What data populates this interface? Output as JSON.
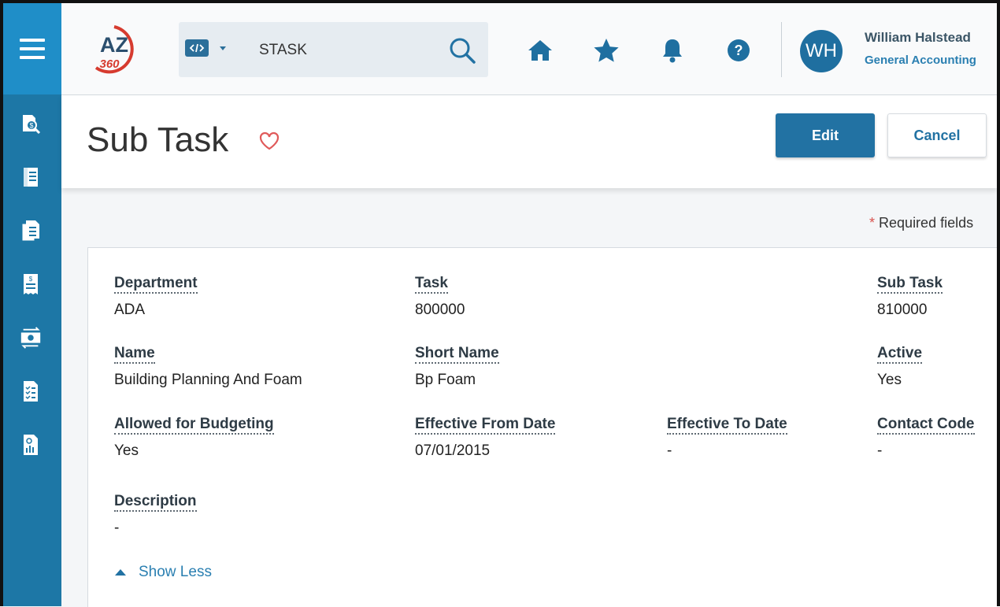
{
  "header": {
    "logo_text": "AZ",
    "logo_sub": "360",
    "search": {
      "value": "STASK",
      "placeholder": ""
    },
    "user": {
      "initials": "WH",
      "name": "William Halstead",
      "department": "General Accounting"
    },
    "icons": [
      "home-icon",
      "star-icon",
      "bell-icon",
      "help-icon"
    ]
  },
  "sidebar": {
    "items": [
      {
        "icon": "money-search-icon"
      },
      {
        "icon": "ledger-book-icon"
      },
      {
        "icon": "documents-icon"
      },
      {
        "icon": "invoice-icon"
      },
      {
        "icon": "cash-transfer-icon"
      },
      {
        "icon": "checklist-icon"
      },
      {
        "icon": "report-chart-icon"
      }
    ]
  },
  "page": {
    "title": "Sub Task",
    "edit_label": "Edit",
    "cancel_label": "Cancel",
    "required_note": "Required fields",
    "required_star": "*"
  },
  "fields": {
    "department": {
      "label": "Department",
      "value": "ADA"
    },
    "task": {
      "label": "Task",
      "value": "800000"
    },
    "sub_task": {
      "label": "Sub Task",
      "value": "810000"
    },
    "name": {
      "label": "Name",
      "value": "Building Planning And Foam"
    },
    "short_name": {
      "label": "Short Name",
      "value": "Bp Foam"
    },
    "active": {
      "label": "Active",
      "value": "Yes"
    },
    "allowed_budgeting": {
      "label": "Allowed for Budgeting",
      "value": "Yes"
    },
    "effective_from": {
      "label": "Effective From Date",
      "value": "07/01/2015"
    },
    "effective_to": {
      "label": "Effective To Date",
      "value": "-"
    },
    "contact_code": {
      "label": "Contact Code",
      "value": "-"
    },
    "description": {
      "label": "Description",
      "value": "-"
    }
  },
  "show_less_label": "Show Less",
  "colors": {
    "sidebar": "#1d77a6",
    "accent": "#2272a3",
    "link": "#2a7fb1",
    "heart": "#e05a5a",
    "logo_red": "#d63b2f"
  }
}
